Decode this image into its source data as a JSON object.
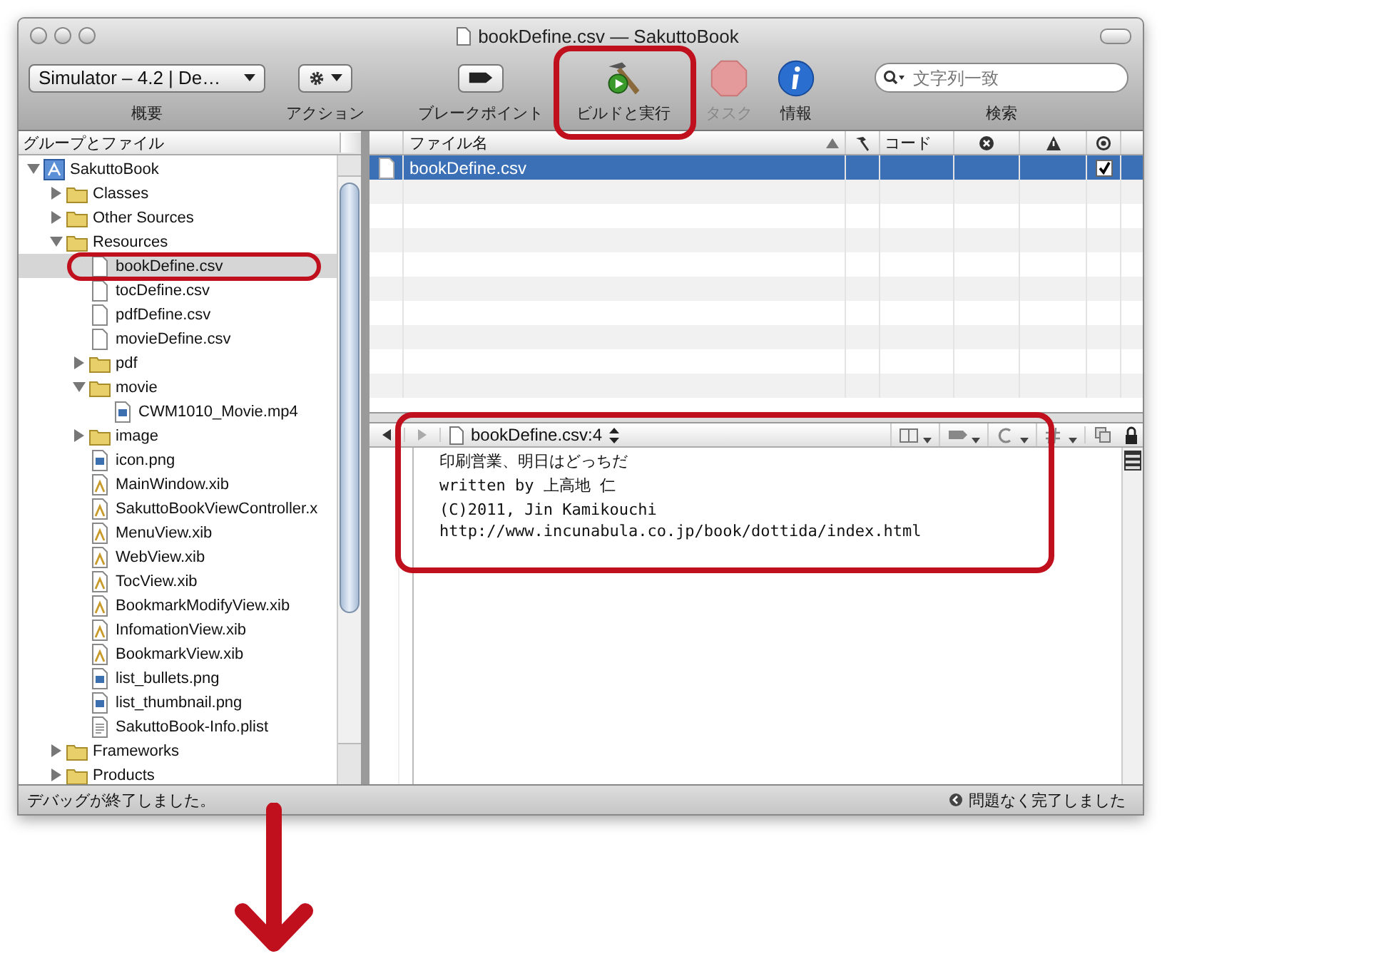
{
  "window": {
    "title": "bookDefine.csv — SakuttoBook"
  },
  "toolbar": [
    {
      "kind": "popup",
      "value": "Simulator – 4.2 | De…",
      "label": "概要"
    },
    {
      "kind": "action",
      "label": "アクション"
    },
    {
      "kind": "breakpoint",
      "label": "ブレークポイント"
    },
    {
      "kind": "build",
      "label": "ビルドと実行"
    },
    {
      "kind": "stop",
      "label": "タスク",
      "disabled": true
    },
    {
      "kind": "info",
      "label": "情報"
    },
    {
      "kind": "search",
      "placeholder": "文字列一致",
      "label": "検索"
    }
  ],
  "sidebar": {
    "header": "グループとファイル",
    "items": [
      {
        "label": "SakuttoBook",
        "kind": "project",
        "expanded": true,
        "selected": false,
        "children": [
          {
            "label": "Classes",
            "kind": "folder",
            "expanded": false,
            "selected": false
          },
          {
            "label": "Other Sources",
            "kind": "folder",
            "expanded": false,
            "selected": false
          },
          {
            "label": "Resources",
            "kind": "folder",
            "expanded": true,
            "selected": false,
            "children": [
              {
                "label": "bookDefine.csv",
                "kind": "doc",
                "selected": true
              },
              {
                "label": "tocDefine.csv",
                "kind": "doc",
                "selected": false
              },
              {
                "label": "pdfDefine.csv",
                "kind": "doc",
                "selected": false
              },
              {
                "label": "movieDefine.csv",
                "kind": "doc",
                "selected": false
              },
              {
                "label": "pdf",
                "kind": "folder",
                "expanded": false,
                "selected": false
              },
              {
                "label": "movie",
                "kind": "folder",
                "expanded": true,
                "selected": false,
                "children": [
                  {
                    "label": "CWM1010_Movie.mp4",
                    "kind": "media",
                    "selected": false
                  }
                ]
              },
              {
                "label": "image",
                "kind": "folder",
                "expanded": false,
                "selected": false
              },
              {
                "label": "icon.png",
                "kind": "media",
                "selected": false
              },
              {
                "label": "MainWindow.xib",
                "kind": "xib",
                "selected": false
              },
              {
                "label": "SakuttoBookViewController.x",
                "kind": "xib",
                "selected": false
              },
              {
                "label": "MenuView.xib",
                "kind": "xib",
                "selected": false
              },
              {
                "label": "WebView.xib",
                "kind": "xib",
                "selected": false
              },
              {
                "label": "TocView.xib",
                "kind": "xib",
                "selected": false
              },
              {
                "label": "BookmarkModifyView.xib",
                "kind": "xib",
                "selected": false
              },
              {
                "label": "InfomationView.xib",
                "kind": "xib",
                "selected": false
              },
              {
                "label": "BookmarkView.xib",
                "kind": "xib",
                "selected": false
              },
              {
                "label": "list_bullets.png",
                "kind": "media",
                "selected": false
              },
              {
                "label": "list_thumbnail.png",
                "kind": "media",
                "selected": false
              },
              {
                "label": "SakuttoBook-Info.plist",
                "kind": "plist",
                "selected": false
              }
            ]
          },
          {
            "label": "Frameworks",
            "kind": "folder",
            "expanded": false,
            "selected": false
          },
          {
            "label": "Products",
            "kind": "folder",
            "expanded": false,
            "selected": false
          }
        ]
      }
    ]
  },
  "table": {
    "columns": [
      {
        "kind": "name",
        "label": "ファイル名"
      },
      {
        "kind": "build"
      },
      {
        "kind": "text",
        "label": "コード"
      },
      {
        "kind": "errors"
      },
      {
        "kind": "warnings"
      },
      {
        "kind": "target"
      }
    ],
    "rows": [
      {
        "name": "bookDefine.csv",
        "selected": true,
        "checked": true
      }
    ]
  },
  "editor": {
    "file": "bookDefine.csv:4",
    "lines": [
      "印刷営業、明日はどっちだ",
      "written by 上高地 仁",
      "(C)2011, Jin Kamikouchi",
      "http://www.incunabula.co.jp/book/dottida/index.html"
    ]
  },
  "status_bar": {
    "left": "デバッグが終了しました。",
    "right": "問題なく完了しました"
  }
}
